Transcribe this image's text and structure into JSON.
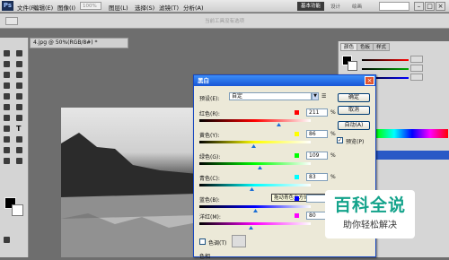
{
  "app": {
    "logo": "Ps"
  },
  "menubar": {
    "items": [
      {
        "label": "文件(F)"
      },
      {
        "label": "编辑(E)"
      },
      {
        "label": "图像(I)"
      },
      {
        "label": "图层(L)"
      },
      {
        "label": "选择(S)"
      },
      {
        "label": "滤镜(T)"
      },
      {
        "label": "分析(A)"
      }
    ],
    "zoom": "100%",
    "workspace_active": "基本功能",
    "workspace_others": [
      "设计",
      "绘画"
    ]
  },
  "optionsbar": {
    "hint": "当前工具没有选项"
  },
  "document": {
    "tab_label": "4.jpg @ 50%(RGB/8#) *"
  },
  "panels": {
    "color_tabs": [
      "颜色",
      "色板",
      "样式"
    ],
    "colors": {
      "red": "#ff0000",
      "green": "#00a800",
      "blue": "#0000ff"
    }
  },
  "dialog": {
    "title": "黑白",
    "preset_label": "预设(E):",
    "preset_value": "自定",
    "buttons": {
      "ok": "确定",
      "cancel": "取消",
      "auto": "自动(A)",
      "preview": "预览(P)"
    },
    "preview_checked": true,
    "rows": [
      {
        "label": "红色(R):",
        "value": "211",
        "unit": "%",
        "swatch": "#ff0000",
        "position": 0.71
      },
      {
        "label": "黄色(Y):",
        "value": "86",
        "unit": "%",
        "swatch": "#ffff00",
        "position": 0.48
      },
      {
        "label": "绿色(G):",
        "value": "109",
        "unit": "%",
        "swatch": "#00ff00",
        "position": 0.54
      },
      {
        "label": "青色(C):",
        "value": "83",
        "unit": "%",
        "swatch": "#00ffff",
        "position": 0.47
      },
      {
        "label": "蓝色(B):",
        "value": "",
        "unit": "%",
        "swatch": "#0000ff",
        "position": 0.5
      },
      {
        "label": "洋红(M):",
        "value": "80",
        "unit": "%",
        "swatch": "#ff00ff",
        "position": 0.46
      }
    ],
    "tooltip": "拖动青色立方体的",
    "tint_label": "色调(T)",
    "tint_checked": false,
    "hue_label": "色相"
  },
  "watermark": {
    "line1": "百科全说",
    "line2": "助你轻松解决"
  }
}
